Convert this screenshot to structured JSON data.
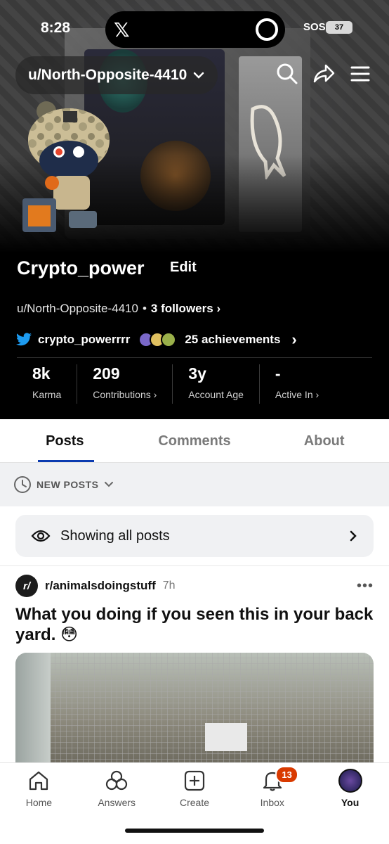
{
  "status_bar": {
    "time": "8:28",
    "sos": "SOS",
    "battery": "37"
  },
  "header": {
    "username_pill": "u/North-Opposite-4410",
    "icons": [
      "search-icon",
      "share-icon",
      "menu-icon"
    ]
  },
  "profile": {
    "display_name": "Crypto_power",
    "edit_label": "Edit",
    "handle": "u/North-Opposite-4410",
    "separator": "•",
    "followers": "3 followers",
    "twitter_handle": "crypto_powerrrr",
    "achievements": "25 achievements"
  },
  "stats": [
    {
      "value": "8k",
      "label": "Karma"
    },
    {
      "value": "209",
      "label": "Contributions"
    },
    {
      "value": "3y",
      "label": "Account Age"
    },
    {
      "value": "-",
      "label": "Active In"
    }
  ],
  "tabs": [
    {
      "label": "Posts"
    },
    {
      "label": "Comments"
    },
    {
      "label": "About"
    }
  ],
  "sort": {
    "label": "NEW POSTS"
  },
  "filter": {
    "label": "Showing all posts"
  },
  "post": {
    "subreddit": "r/animalsdoingstuff",
    "age": "7h",
    "more": "•••",
    "title": "What you doing if you seen this in your back yard. 😳"
  },
  "bottom_nav": {
    "items": [
      {
        "label": "Home"
      },
      {
        "label": "Answers"
      },
      {
        "label": "Create"
      },
      {
        "label": "Inbox",
        "badge": "13"
      },
      {
        "label": "You"
      }
    ]
  },
  "colors": {
    "accent_underline": "#0b3bb0",
    "badge_orange": "#d93a00",
    "twitter_blue": "#1d9bf0"
  }
}
